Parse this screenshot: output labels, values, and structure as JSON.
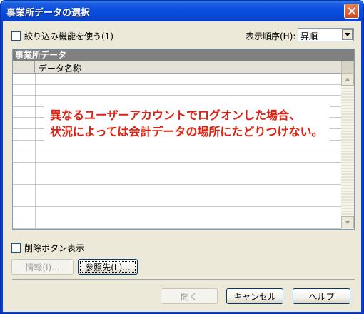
{
  "window": {
    "title": "事業所データの選択"
  },
  "filter": {
    "label": "絞り込み機能を使う(1)"
  },
  "sort": {
    "label": "表示順序(H):",
    "value": "昇順"
  },
  "grid": {
    "caption": "事業所データ",
    "column_header": "データ名称"
  },
  "annotation": {
    "line1": "異なるユーザーアカウントでログオンした場合、",
    "line2": "状況によっては会計データの場所にたどりつけない。"
  },
  "delete_toggle": {
    "label": "削除ボタン表示"
  },
  "buttons": {
    "info": "情報(I)...",
    "browse": "参照先(L)...",
    "open": "開く",
    "cancel": "キャンセル",
    "help": "ヘルプ"
  },
  "colors": {
    "titlebar": "#0a4ee0",
    "annotation_text": "#e02010"
  }
}
